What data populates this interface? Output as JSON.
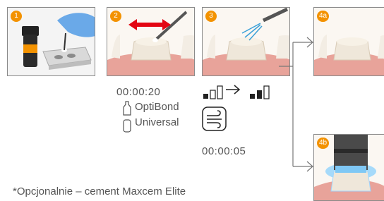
{
  "steps": [
    {
      "badge": "1"
    },
    {
      "badge": "2",
      "time": "00:00:20"
    },
    {
      "badge": "3",
      "time": "00:00:05"
    },
    {
      "badge": "4a"
    },
    {
      "badge": "4b"
    }
  ],
  "product": {
    "line1": "OptiBond",
    "line2": "Universal"
  },
  "footnote": "*Opcjonalnie – cement Maxcem Elite",
  "colors": {
    "badge": "#f39200",
    "arrow": "#e30613",
    "air": "#3aa0d8",
    "light_ring": "#6ec6ff",
    "text": "#555555"
  },
  "icons": [
    "adhesive-bottle-icon",
    "double-arrow-icon",
    "air-spray-icon",
    "air-pressure-levels-icon",
    "air-flow-icon",
    "curing-light-icon"
  ]
}
